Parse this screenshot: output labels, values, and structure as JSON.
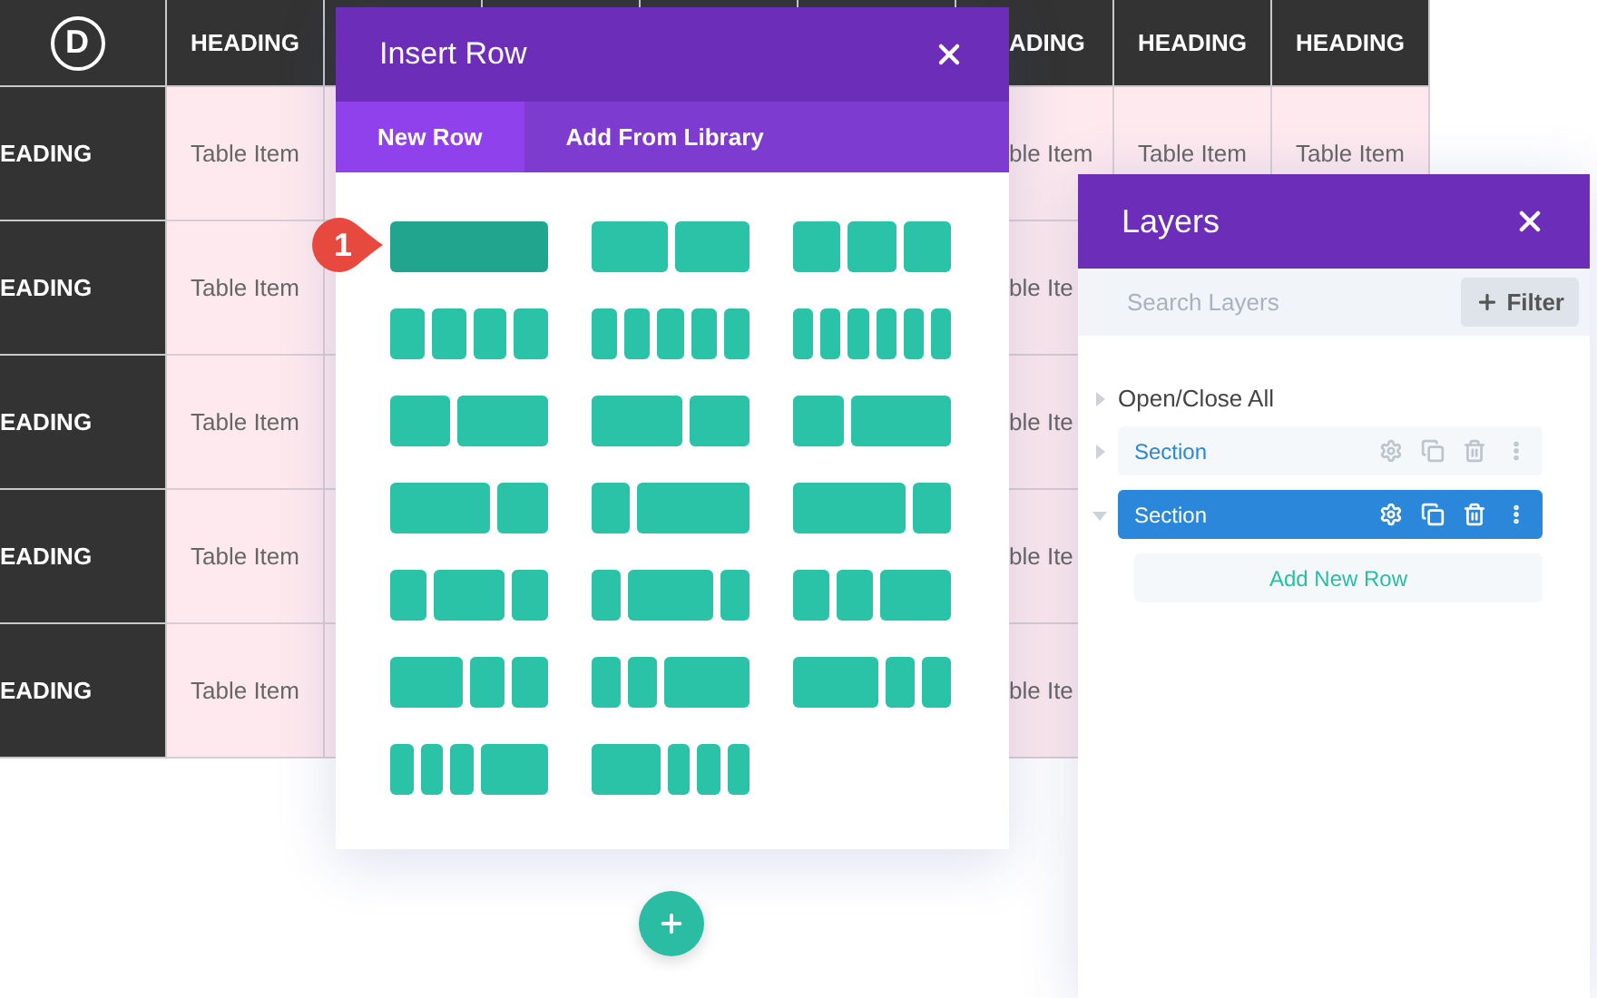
{
  "table": {
    "columns": [
      {
        "kind": "logo",
        "text": "D"
      },
      {
        "kind": "heading",
        "text": "HEADING"
      },
      {
        "kind": "blank"
      },
      {
        "kind": "blank"
      },
      {
        "kind": "blank"
      },
      {
        "kind": "blank"
      },
      {
        "kind": "heading",
        "text": "ADING",
        "clipped": true
      },
      {
        "kind": "heading",
        "text": "HEADING"
      },
      {
        "kind": "heading",
        "text": "HEADING"
      }
    ],
    "rows": [
      {
        "cells": [
          "EADING",
          "Table Item",
          null,
          null,
          null,
          null,
          "ble Item",
          "Table Item",
          "Table Item"
        ]
      },
      {
        "cells": [
          "EADING",
          "Table Item",
          null,
          null,
          null,
          null,
          "ble Ite",
          null,
          null
        ]
      },
      {
        "cells": [
          "EADING",
          "Table Item",
          null,
          null,
          null,
          null,
          "ble Ite",
          null,
          null
        ]
      },
      {
        "cells": [
          "EADING",
          "Table Item",
          null,
          null,
          null,
          null,
          "ble Ite",
          null,
          null
        ]
      },
      {
        "cells": [
          "EADING",
          "Table Item",
          null,
          null,
          null,
          null,
          "ble Ite",
          null,
          null
        ]
      }
    ]
  },
  "insert_row": {
    "title": "Insert Row",
    "tabs": [
      {
        "label": "New Row",
        "selected": true
      },
      {
        "label": "Add From Library",
        "selected": false
      }
    ],
    "layouts": [
      {
        "kind": "full",
        "selected": true
      },
      {
        "kind": "halves",
        "selected": false
      },
      {
        "kind": "thirds",
        "selected": false
      },
      {
        "kind": "quarters",
        "selected": false
      },
      {
        "kind": "fifths",
        "selected": false
      },
      {
        "kind": "sixths",
        "selected": false
      },
      {
        "kind": "two-fifths-three-fifths",
        "selected": false
      },
      {
        "kind": "three-fifths-two-fifths",
        "selected": false
      },
      {
        "kind": "third-two-thirds",
        "selected": false
      },
      {
        "kind": "two-thirds-third",
        "selected": false
      },
      {
        "kind": "quarter-three-quarters",
        "selected": false
      },
      {
        "kind": "three-quarters-quarter",
        "selected": false
      },
      {
        "kind": "quarter-half-quarter",
        "selected": false
      },
      {
        "kind": "fifth-three-fifths-fifth",
        "selected": false
      },
      {
        "kind": "quarter-quarter-half",
        "selected": false
      },
      {
        "kind": "half-quarter-quarter",
        "selected": false
      },
      {
        "kind": "fifth-fifth-three-fifths",
        "selected": false
      },
      {
        "kind": "three-fifths-fifth-fifth",
        "selected": false
      },
      {
        "kind": "sixths-half",
        "selected": false
      },
      {
        "kind": "half-sixths",
        "selected": false
      }
    ],
    "step_badge": "1"
  },
  "layers": {
    "title": "Layers",
    "search": {
      "placeholder": "Search Layers"
    },
    "filter_button": "Filter",
    "open_close_all": "Open/Close All",
    "items": [
      {
        "label": "Section",
        "selected": false,
        "expanded": false
      },
      {
        "label": "Section",
        "selected": true,
        "expanded": true,
        "children": [
          {
            "kind": "add",
            "label": "Add New Row"
          }
        ]
      }
    ]
  }
}
